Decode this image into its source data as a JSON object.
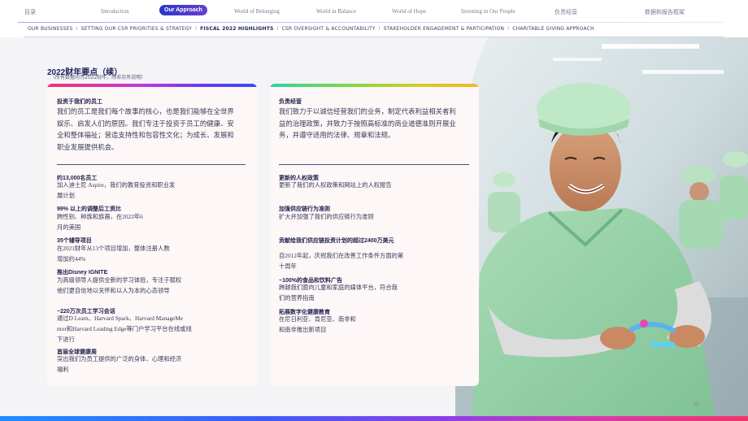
{
  "topnav": {
    "items": [
      "目录",
      "Introduction",
      "Our Approach",
      "World of Belonging",
      "World in Balance",
      "World of Hope",
      "Investing in Our People",
      "负责经营",
      "数据和报告框架"
    ],
    "active_index": 2
  },
  "subnav": {
    "items": [
      "OUR BUSINESSES",
      "SETTING OUR CSR PRIORITIES & STRATEGY",
      "FISCAL 2022 HIGHLIGHTS",
      "CSR OVERSIGHT & ACCOUNTABILITY",
      "STAKEHOLDER ENGAGEMENT & PARTICIPATION",
      "CHARITABLE GIVING APPROACH"
    ],
    "active_index": 2,
    "separator": "I"
  },
  "page": {
    "title": "2022财年要点（续）",
    "subtitle": "（所有数据均为2022财年，除非另有说明）",
    "page_number": "08"
  },
  "left_card": {
    "heading": "投资于我们的员工",
    "intro": [
      "我们的员工是我们每个故事的核心，也是我们能够在全世界",
      "娱乐、启发人们的原因。我们专注于投资于员工的健康、安",
      "全和整体福祉；营造支持性和包容性文化；为成长、发展和",
      "职业发展提供机会。"
    ],
    "items": [
      {
        "heading": "约13,000名员工",
        "text": [
          "加入迪士尼 Aspire，我们的教育投资和职业发",
          "展计划"
        ]
      },
      {
        "heading": "99% 以上的调整后工资比",
        "text": [
          "跨性别、种族和族裔，在2022年6",
          "月的美国"
        ]
      },
      {
        "heading": "35个辅导项目",
        "text": [
          "在2021财年从13个项目增加，整体注册人数",
          "增加约44%"
        ]
      },
      {
        "heading": "推出Disney IGNITE",
        "text": [
          "为高级领导人提供全新的学习体验，专注于赋权",
          "他们更自信地以关怀和以人为本的心态领导"
        ]
      },
      {
        "heading": "~220万次员工学习会话",
        "text": [
          "通过D Learn、Harvard Spark、Harvard ManageMe",
          "ntor和Harvard Leading Edge等门户学习平台在线或线",
          "下进行"
        ]
      },
      {
        "heading": "首届全球健康周",
        "text": [
          "突出我们为员工提供的广泛的身体、心理和经济",
          "福利"
        ]
      }
    ]
  },
  "right_card": {
    "heading": "负责经营",
    "intro": [
      "我们致力于以诚信经营我们的业务，制定代表利益相关者利",
      "益的治理政策，并致力于按照高标准的商业道德准则开展业",
      "务，并遵守适用的法律、规章和法规。"
    ],
    "items": [
      {
        "heading": "更新的人权政策",
        "text": [
          "更新了我们的人权政策和网站上的人权报告"
        ]
      },
      {
        "heading": "加强供应链行为准则",
        "text": [
          "扩大并加强了我们的供应链行为准则"
        ]
      },
      {
        "heading": "贡献给我们供应链投资计划的超过2400万美元",
        "text": [
          "自2012年起，庆祝我们在改善工作条件方面的第",
          "十周年"
        ]
      },
      {
        "heading": "~100%的食品和饮料广告",
        "text": [
          "跨越我们面向儿童和家庭的媒体平台，符合我",
          "们的营养指南"
        ]
      },
      {
        "heading": "拓展数字化健康教育",
        "text": [
          "在尼日利亚、肯尼亚、南非和",
          "和南非推出新项目"
        ]
      }
    ]
  },
  "colors": {
    "brand_dark": "#1e1f5c",
    "active_tab": "#2b34c8",
    "card_bg": "#fdf8f7"
  },
  "photo": {
    "description_icon": "worker-photo"
  }
}
